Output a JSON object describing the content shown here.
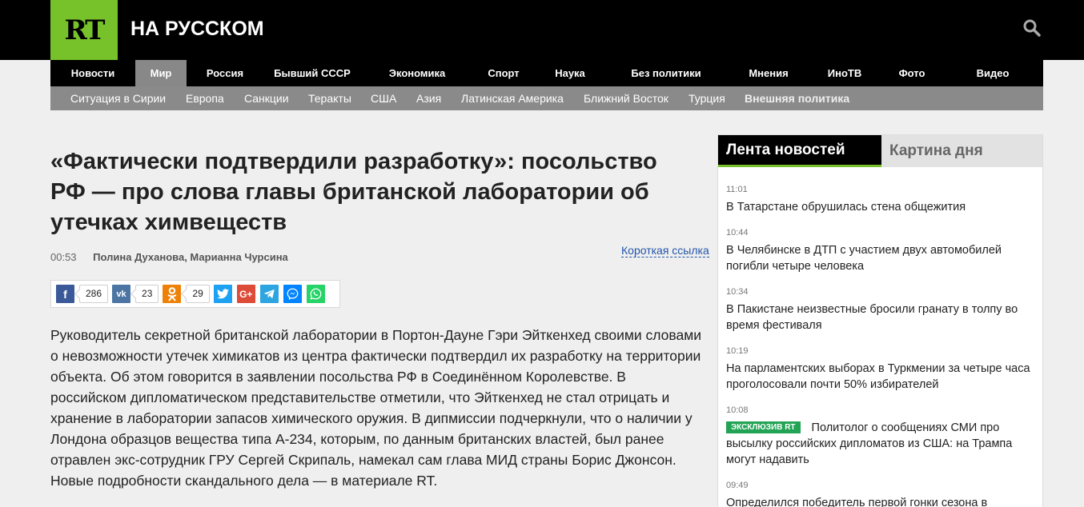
{
  "header": {
    "logo_text": "RT",
    "site_name": "НА РУССКОМ"
  },
  "mainnav": [
    {
      "label": "Новости",
      "active": false
    },
    {
      "label": "Мир",
      "active": true
    },
    {
      "label": "Россия",
      "active": false
    },
    {
      "label": "Бывший СССР",
      "active": false
    },
    {
      "label": "Экономика",
      "active": false
    },
    {
      "label": "Спорт",
      "active": false
    },
    {
      "label": "Наука",
      "active": false
    },
    {
      "label": "Без политики",
      "active": false
    },
    {
      "label": "Мнения",
      "active": false
    },
    {
      "label": "ИноТВ",
      "active": false
    },
    {
      "label": "Фото",
      "active": false
    },
    {
      "label": "Видео",
      "active": false
    }
  ],
  "subnav": [
    "Ситуация в Сирии",
    "Европа",
    "Санкции",
    "Теракты",
    "США",
    "Азия",
    "Латинская Америка",
    "Ближний Восток",
    "Турция",
    "Внешняя политика"
  ],
  "article": {
    "headline": "«Фактически подтвердили разработку»: посольство РФ — про слова главы британской лаборатории об утечках химвеществ",
    "time": "00:53",
    "authors": "Полина Духанова, Марианна Чурсина",
    "short_link": "Короткая ссылка",
    "lead": "Руководитель секретной британской лаборатории в Портон-Дауне Гэри Эйткенхед своими словами о невозможности утечек химикатов из центра фактически подтвердил их разработку на территории объекта. Об этом говорится в заявлении посольства РФ в Соединённом Королевстве. В российском дипломатическом представительстве отметили, что Эйткенхед не стал отрицать и хранение в лаборатории запасов химического оружия. В дипмиссии подчеркнули, что о наличии у Лондона образцов вещества типа А-234, которым, по данным британских властей, был ранее отравлен экс-сотрудник ГРУ Сергей Скрипаль, намекал сам глава МИД страны Борис Джонсон. Новые подробности скандального дела — в материале RT."
  },
  "share": {
    "facebook": {
      "icon": "facebook-icon",
      "glyph": "f",
      "count": "286",
      "color": "#3b5998"
    },
    "vk": {
      "icon": "vk-icon",
      "glyph": "vk",
      "count": "23",
      "color": "#4c75a3"
    },
    "ok": {
      "icon": "odnoklassniki-icon",
      "glyph": "ok",
      "count": "29",
      "color": "#ee8208"
    },
    "twitter": {
      "icon": "twitter-icon",
      "color": "#1da1f2"
    },
    "googleplus": {
      "icon": "google-plus-icon",
      "glyph": "G+",
      "color": "#dd4b39"
    },
    "telegram": {
      "icon": "telegram-icon",
      "color": "#2ca5e0"
    },
    "messenger": {
      "icon": "messenger-icon",
      "color": "#0084ff"
    },
    "whatsapp": {
      "icon": "whatsapp-icon",
      "color": "#25d366"
    }
  },
  "feed": {
    "tab_feed": "Лента новостей",
    "tab_picture": "Картина дня",
    "items": [
      {
        "time": "11:01",
        "title": "В Татарстане обрушилась стена общежития",
        "badge": ""
      },
      {
        "time": "10:44",
        "title": "В Челябинске в ДТП с участием двух автомобилей погибли четыре человека",
        "badge": ""
      },
      {
        "time": "10:34",
        "title": "В Пакистане неизвестные бросили гранату в толпу во время фестиваля",
        "badge": ""
      },
      {
        "time": "10:19",
        "title": "На парламентских выборах в Туркмении за четыре часа проголосовали почти 50% избирателей",
        "badge": ""
      },
      {
        "time": "10:08",
        "title": "Политолог о сообщениях СМИ про высылку российских дипломатов из США: на Трампа могут надавить",
        "badge": "ЭКСКЛЮЗИВ RT"
      },
      {
        "time": "09:49",
        "title": "Определился победитель первой гонки сезона в",
        "badge": ""
      }
    ]
  },
  "colors": {
    "brand_green": "#77c22b",
    "header_bg": "#000000",
    "subnav_bg": "#8a8a8a",
    "link_blue": "#2255aa",
    "badge_green": "#23a455"
  }
}
